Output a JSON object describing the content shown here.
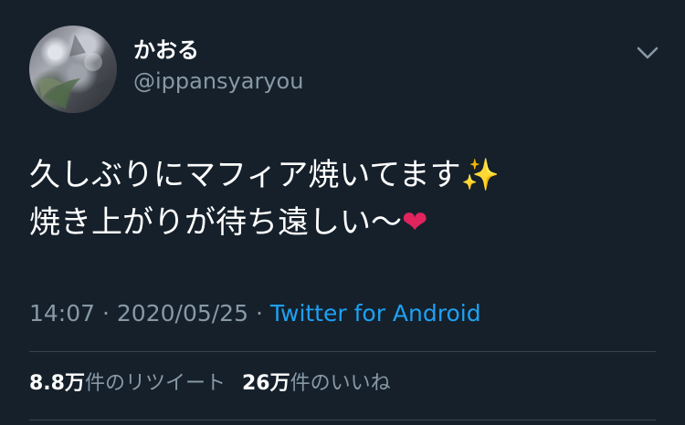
{
  "user": {
    "display_name": "かおる",
    "handle": "@ippansyaryou"
  },
  "tweet": {
    "line1_text": "久しぶりにマフィア焼いてます",
    "line1_emoji": "✨",
    "line2_text": "焼き上がりが待ち遠しい〜",
    "line2_emoji": "❤"
  },
  "meta": {
    "time": "14:07",
    "separator": "·",
    "date": "2020/05/25",
    "source": "Twitter for Android"
  },
  "stats": {
    "retweet_count": "8.8万",
    "retweet_label": "件のリツイート",
    "like_count": "26万",
    "like_label": "件のいいね"
  },
  "icons": {
    "caret": "chevron-down-icon",
    "avatar": "avatar"
  },
  "colors": {
    "background": "#15202b",
    "text": "#ffffff",
    "secondary": "#8899a6",
    "link": "#1da1f2",
    "divider": "#38444d"
  }
}
